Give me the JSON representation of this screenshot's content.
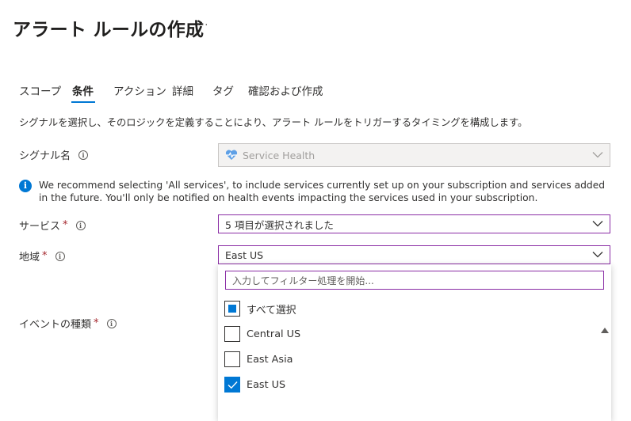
{
  "page": {
    "title": "アラート ルールの作成",
    "more": "···"
  },
  "tabs": [
    {
      "label": "スコープ"
    },
    {
      "label": "条件"
    },
    {
      "label": "アクション"
    },
    {
      "label": "詳細"
    },
    {
      "label": "タグ"
    },
    {
      "label": "確認および作成"
    }
  ],
  "description": "シグナルを選択し、そのロジックを定義することにより、アラート ルールをトリガーするタイミングを構成します。",
  "signal": {
    "label": "シグナル名",
    "value": "Service Health",
    "icon": "heart-pulse-icon"
  },
  "info_message": "We recommend selecting 'All services', to include services currently set up on your subscription and services added in the future. You'll only be notified on health events impacting the services used in your subscription.",
  "services": {
    "label": "サービス",
    "required_mark": "*",
    "value": "5 項目が選択されました"
  },
  "region": {
    "label": "地域",
    "required_mark": "*",
    "value": "East US",
    "filter_placeholder": "入力してフィルター処理を開始...",
    "options": [
      {
        "label": "すべて選択",
        "state": "partial"
      },
      {
        "label": "Central US",
        "state": "unchecked"
      },
      {
        "label": "East Asia",
        "state": "unchecked"
      },
      {
        "label": "East US",
        "state": "checked"
      }
    ]
  },
  "event_type": {
    "label": "イベントの種類",
    "required_mark": "*"
  },
  "colors": {
    "accent": "#0078d4",
    "focus_border": "#8a2da5",
    "required": "#a4262c"
  }
}
